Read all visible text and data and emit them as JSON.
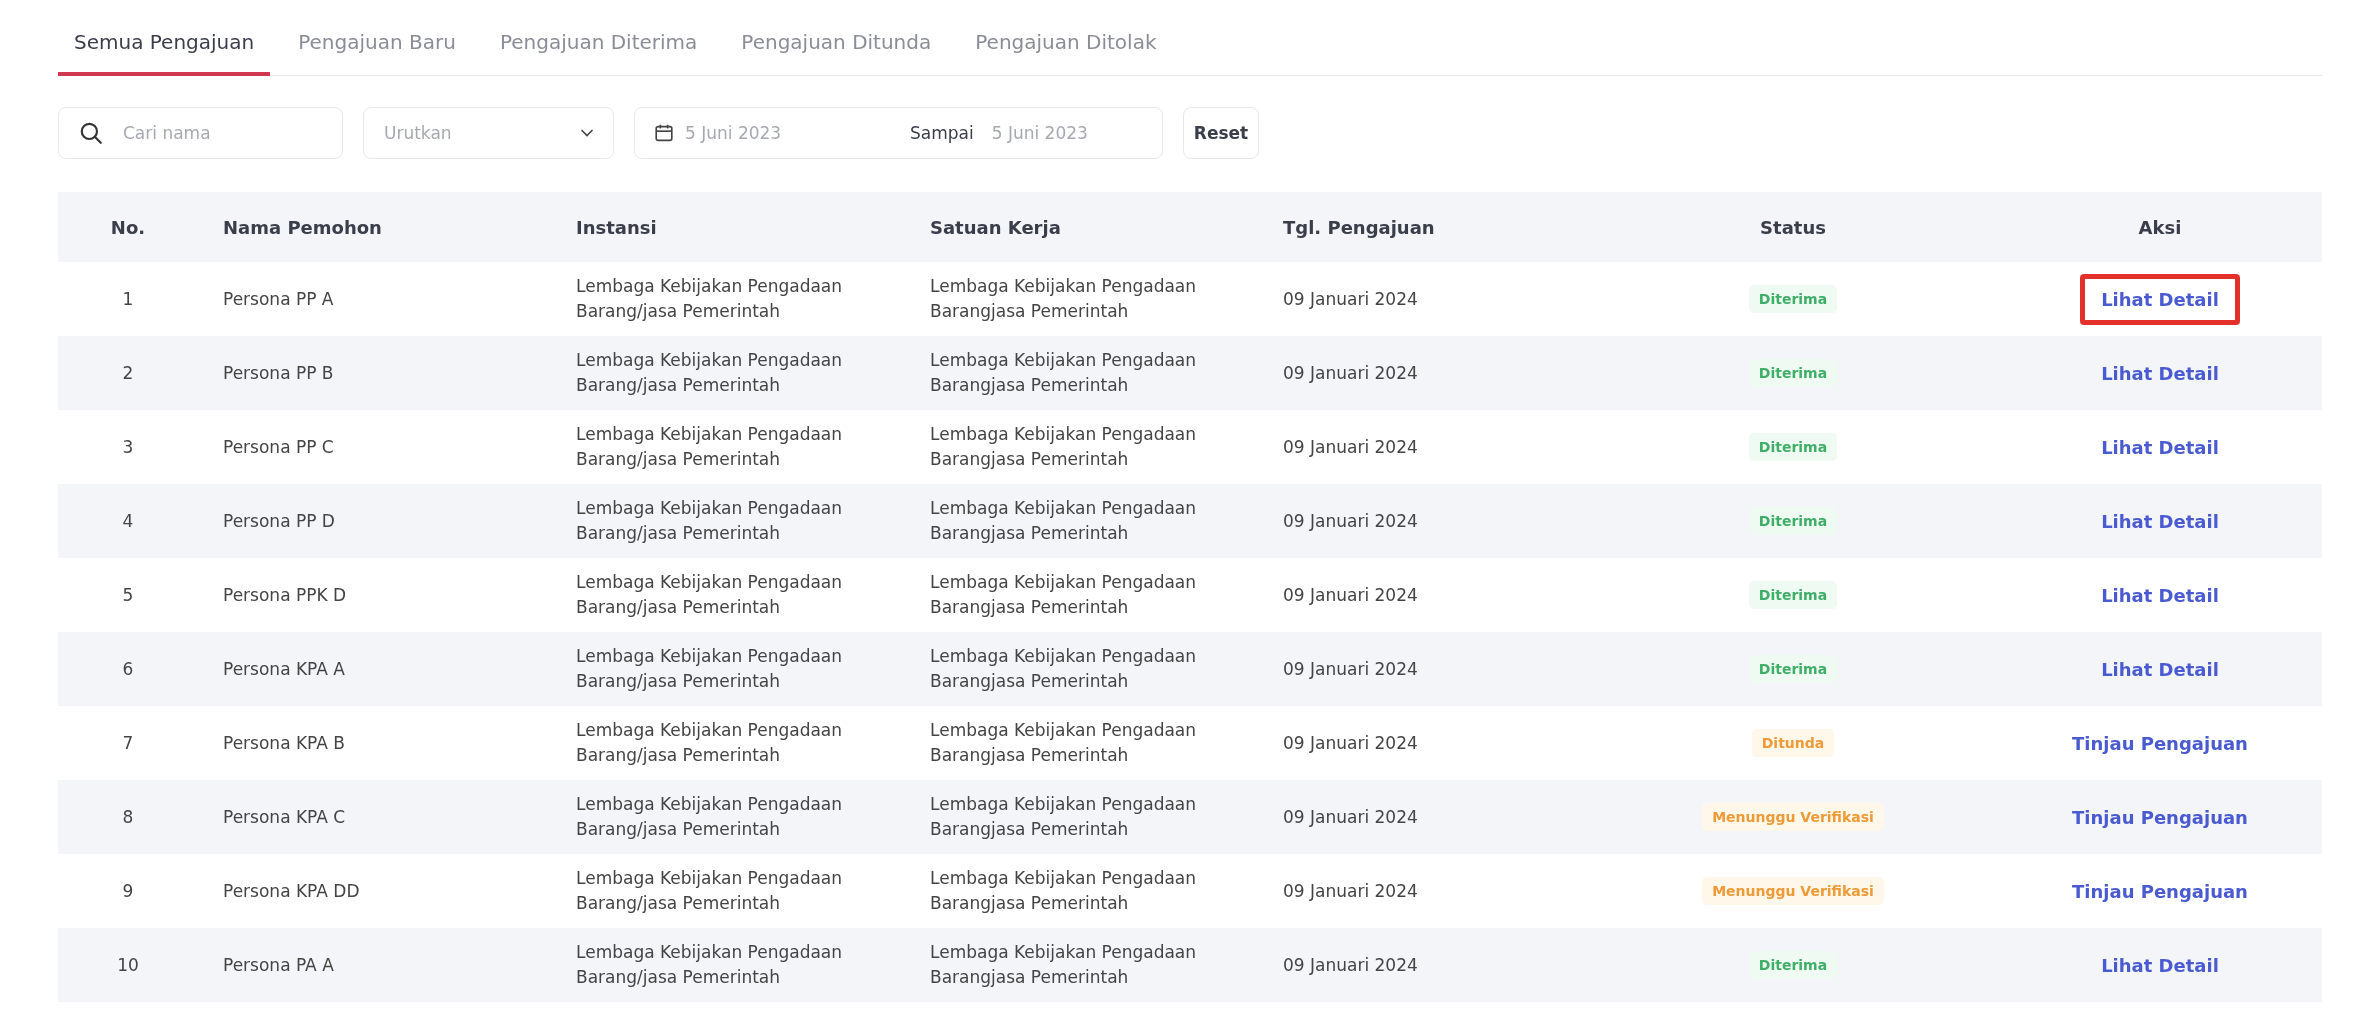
{
  "tabs": [
    {
      "label": "Semua Pengajuan",
      "selected": true
    },
    {
      "label": "Pengajuan Baru",
      "selected": false
    },
    {
      "label": "Pengajuan Diterima",
      "selected": false
    },
    {
      "label": "Pengajuan Ditunda",
      "selected": false
    },
    {
      "label": "Pengajuan Ditolak",
      "selected": false
    }
  ],
  "filters": {
    "search": {
      "placeholder": "Cari nama"
    },
    "sort": {
      "placeholder": "Urutkan"
    },
    "date_from": {
      "value": "5 Juni 2023"
    },
    "date_to_label": "Sampai",
    "date_to": {
      "value": "5 Juni 2023"
    },
    "reset": "Reset"
  },
  "table": {
    "columns": [
      "No.",
      "Nama Pemohon",
      "Instansi",
      "Satuan Kerja",
      "Tgl. Pengajuan",
      "Status",
      "Aksi"
    ],
    "rows": [
      {
        "no": "1",
        "name": "Persona PP A",
        "instansi": "Lembaga Kebijakan Pengadaan Barang/jasa Pemerintah",
        "satuan": "Lembaga Kebijakan Pengadaan Barangjasa Pemerintah",
        "date": "09 Januari 2024",
        "status": {
          "label": "Diterima",
          "kind": "accepted"
        },
        "action": "Lihat Detail",
        "highlighted": true
      },
      {
        "no": "2",
        "name": "Persona PP B",
        "instansi": "Lembaga Kebijakan Pengadaan Barang/jasa Pemerintah",
        "satuan": "Lembaga Kebijakan Pengadaan Barangjasa Pemerintah",
        "date": "09 Januari 2024",
        "status": {
          "label": "Diterima",
          "kind": "accepted"
        },
        "action": "Lihat Detail",
        "highlighted": false
      },
      {
        "no": "3",
        "name": "Persona PP C",
        "instansi": "Lembaga Kebijakan Pengadaan Barang/jasa Pemerintah",
        "satuan": "Lembaga Kebijakan Pengadaan Barangjasa Pemerintah",
        "date": "09 Januari 2024",
        "status": {
          "label": "Diterima",
          "kind": "accepted"
        },
        "action": "Lihat Detail",
        "highlighted": false
      },
      {
        "no": "4",
        "name": "Persona PP D",
        "instansi": "Lembaga Kebijakan Pengadaan Barang/jasa Pemerintah",
        "satuan": "Lembaga Kebijakan Pengadaan Barangjasa Pemerintah",
        "date": "09 Januari 2024",
        "status": {
          "label": "Diterima",
          "kind": "accepted"
        },
        "action": "Lihat Detail",
        "highlighted": false
      },
      {
        "no": "5",
        "name": "Persona PPK D",
        "instansi": "Lembaga Kebijakan Pengadaan Barang/jasa Pemerintah",
        "satuan": "Lembaga Kebijakan Pengadaan Barangjasa Pemerintah",
        "date": "09 Januari 2024",
        "status": {
          "label": "Diterima",
          "kind": "accepted"
        },
        "action": "Lihat Detail",
        "highlighted": false
      },
      {
        "no": "6",
        "name": "Persona KPA A",
        "instansi": "Lembaga Kebijakan Pengadaan Barang/jasa Pemerintah",
        "satuan": "Lembaga Kebijakan Pengadaan Barangjasa Pemerintah",
        "date": "09 Januari 2024",
        "status": {
          "label": "Diterima",
          "kind": "accepted"
        },
        "action": "Lihat Detail",
        "highlighted": false
      },
      {
        "no": "7",
        "name": "Persona KPA B",
        "instansi": "Lembaga Kebijakan Pengadaan Barang/jasa Pemerintah",
        "satuan": "Lembaga Kebijakan Pengadaan Barangjasa Pemerintah",
        "date": "09 Januari 2024",
        "status": {
          "label": "Ditunda",
          "kind": "pending"
        },
        "action": "Tinjau Pengajuan",
        "highlighted": false
      },
      {
        "no": "8",
        "name": "Persona KPA C",
        "instansi": "Lembaga Kebijakan Pengadaan Barang/jasa Pemerintah",
        "satuan": "Lembaga Kebijakan Pengadaan Barangjasa Pemerintah",
        "date": "09 Januari 2024",
        "status": {
          "label": "Menunggu Verifikasi",
          "kind": "pending"
        },
        "action": "Tinjau Pengajuan",
        "highlighted": false
      },
      {
        "no": "9",
        "name": "Persona KPA DD",
        "instansi": "Lembaga Kebijakan Pengadaan Barang/jasa Pemerintah",
        "satuan": "Lembaga Kebijakan Pengadaan Barangjasa Pemerintah",
        "date": "09 Januari 2024",
        "status": {
          "label": "Menunggu Verifikasi",
          "kind": "pending"
        },
        "action": "Tinjau Pengajuan",
        "highlighted": false
      },
      {
        "no": "10",
        "name": "Persona PA A",
        "instansi": "Lembaga Kebijakan Pengadaan Barang/jasa Pemerintah",
        "satuan": "Lembaga Kebijakan Pengadaan Barangjasa Pemerintah",
        "date": "09 Januari 2024",
        "status": {
          "label": "Diterima",
          "kind": "accepted"
        },
        "action": "Lihat Detail",
        "highlighted": false
      }
    ]
  }
}
